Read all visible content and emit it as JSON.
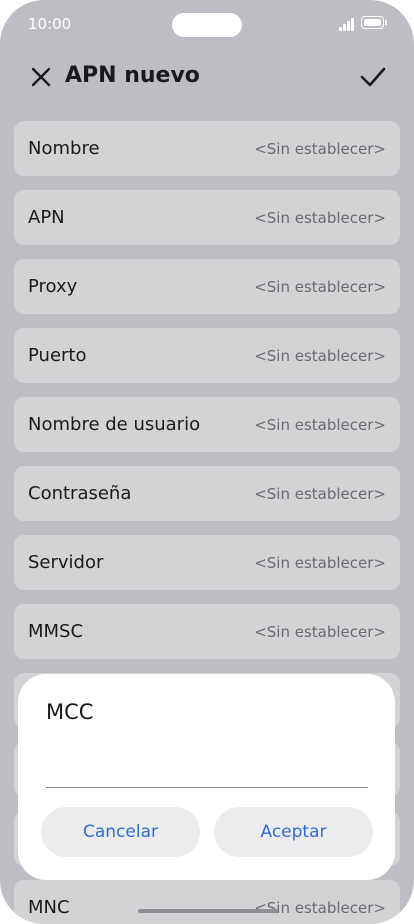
{
  "status_bar": {
    "time": "10:00"
  },
  "header": {
    "title": "APN nuevo",
    "close_icon": "close-icon",
    "confirm_icon": "checkmark-icon"
  },
  "fields": [
    {
      "label": "Nombre",
      "value": "<Sin establecer>"
    },
    {
      "label": "APN",
      "value": "<Sin establecer>"
    },
    {
      "label": "Proxy",
      "value": "<Sin establecer>"
    },
    {
      "label": "Puerto",
      "value": "<Sin establecer>"
    },
    {
      "label": "Nombre de usuario",
      "value": "<Sin establecer>"
    },
    {
      "label": "Contraseña",
      "value": "<Sin establecer>"
    },
    {
      "label": "Servidor",
      "value": "<Sin establecer>"
    },
    {
      "label": "MMSC",
      "value": "<Sin establecer>"
    },
    {
      "label": "MNC",
      "value": "<Sin establecer>"
    }
  ],
  "dialog": {
    "title": "MCC",
    "input_value": "",
    "cancel_label": "Cancelar",
    "accept_label": "Aceptar"
  },
  "colors": {
    "accent": "#2f6bd8",
    "dim_background": "#bdbec3"
  }
}
